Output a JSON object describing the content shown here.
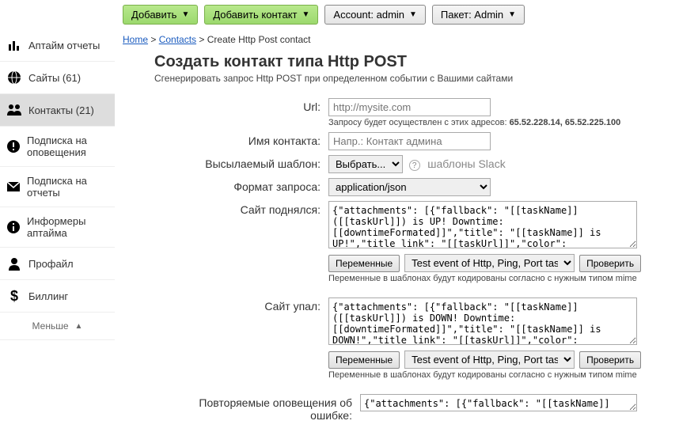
{
  "topbar": {
    "add": "Добавить",
    "addContact": "Добавить контакт",
    "account": "Account: admin",
    "package": "Пакет: Admin"
  },
  "breadcrumb": {
    "home": "Home",
    "contacts": "Contacts",
    "current": "Create Http Post contact"
  },
  "sidebar": {
    "items": [
      {
        "label": "Аптайм отчеты"
      },
      {
        "label": "Сайты (61)"
      },
      {
        "label": "Контакты (21)"
      },
      {
        "label": "Подписка на оповещения"
      },
      {
        "label": "Подписка на отчеты"
      },
      {
        "label": "Информеры аптайма"
      },
      {
        "label": "Профайл"
      },
      {
        "label": "Биллинг"
      }
    ],
    "less": "Меньше"
  },
  "page": {
    "title": "Создать контакт типа Http POST",
    "subtitle": "Сгенерировать запрос Http POST при определенном событии с Вашими сайтами"
  },
  "form": {
    "url": {
      "label": "Url:",
      "placeholder": "http://mysite.com",
      "hint_pre": "Запросу будет осуществлен с этих адресов: ",
      "hint_ips": "65.52.228.14, 65.52.225.100"
    },
    "name": {
      "label": "Имя контакта:",
      "placeholder": "Напр.: Контакт админа"
    },
    "template": {
      "label": "Высылаемый шаблон:",
      "select": "Выбрать...",
      "slack": "шаблоны Slack"
    },
    "format": {
      "label": "Формат запроса:",
      "value": "application/json"
    },
    "siteUp": {
      "label": "Сайт поднялся:",
      "value": "{\"attachments\": [{\"fallback\": \"[[taskName]] ([[taskUrl]]) is UP! Downtime:[[downtimeFormated]]\",\"title\": \"[[taskName]] is UP!\",\"title_link\": \"[[taskUrl]]\",\"color\":"
    },
    "siteDown": {
      "label": "Сайт упал:",
      "value": "{\"attachments\": [{\"fallback\": \"[[taskName]] ([[taskUrl]]) is DOWN! Downtime:[[downtimeFormated]]\",\"title\": \"[[taskName]] is DOWN!\",\"title_link\": \"[[taskUrl]]\",\"color\":"
    },
    "repeat": {
      "label": "Повторяемые оповещения об ошибке:",
      "value": "{\"attachments\": [{\"fallback\": \"[[taskName]]"
    },
    "buttons": {
      "vars": "Переменные",
      "test": "Test event of Http, Ping, Port task",
      "check": "Проверить"
    },
    "encodeHint": "Переменные в шаблонах будут кодированы согласно с нужным типом mime"
  }
}
